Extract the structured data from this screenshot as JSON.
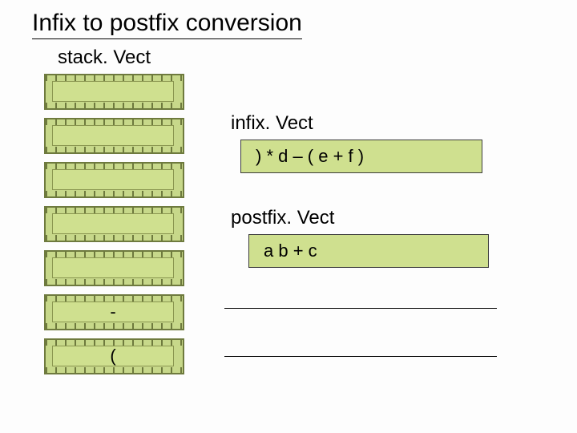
{
  "title": "Infix to postfix conversion",
  "stack": {
    "label": "stack. Vect",
    "slots": [
      {
        "value": ""
      },
      {
        "value": ""
      },
      {
        "value": ""
      },
      {
        "value": ""
      },
      {
        "value": ""
      },
      {
        "value": "-"
      },
      {
        "value": "("
      }
    ]
  },
  "infix": {
    "label": "infix. Vect",
    "value": ") * d – ( e + f )"
  },
  "postfix": {
    "label": "postfix. Vect",
    "value": "a b + c"
  }
}
